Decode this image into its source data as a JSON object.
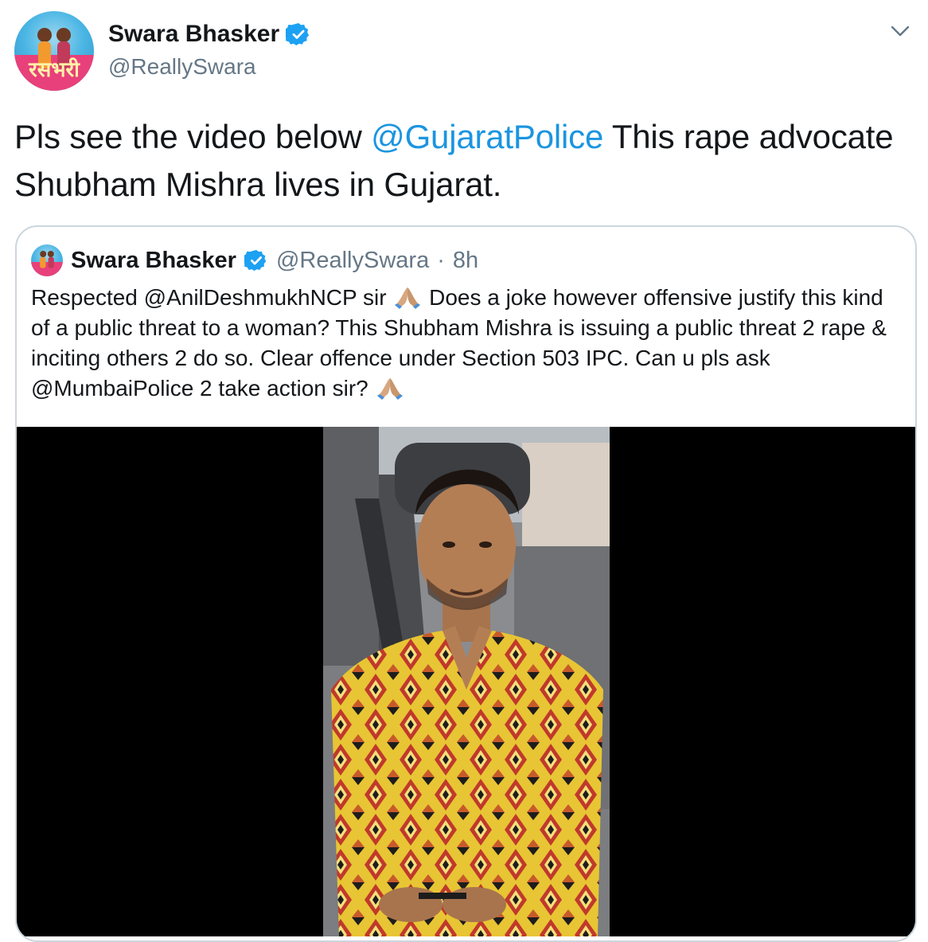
{
  "author": {
    "name": "Swara Bhasker",
    "handle": "@ReallySwara",
    "verified": true,
    "avatar_icon": "profile-photo"
  },
  "tweet": {
    "text_before": "Pls see the video below ",
    "mention": "@GujaratPolice",
    "text_after": " This rape advocate Shubham Mishra lives in Gujarat."
  },
  "quoted_tweet": {
    "name": "Swara Bhasker",
    "handle": "@ReallySwara",
    "separator": "·",
    "time": "8h",
    "text_parts": {
      "p1": "Respected ",
      "mention1": "@AnilDeshmukhNCP",
      "p2": " sir ",
      "p3": " Does a joke however offensive justify this kind of a public threat to a woman? This Shubham Mishra is issuing a public threat 2 rape & inciting others 2 do so. Clear offence under Section 503 IPC. Can u pls ask ",
      "mention2": "@MumbaiPolice",
      "p4": " 2 take action sir? "
    },
    "emoji": "folded-hands-medium-skin-tone",
    "media_type": "video"
  },
  "colors": {
    "link": "#1b95e0",
    "secondary_text": "#657786",
    "border": "#ccd6dd",
    "verified": "#1da1f2"
  }
}
